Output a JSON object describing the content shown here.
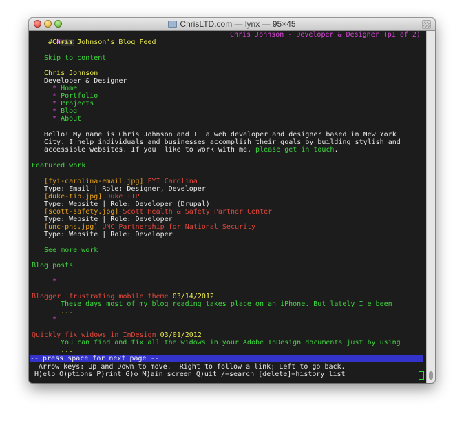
{
  "window": {
    "title": "ChrisLTD.com — lynx — 95×45"
  },
  "lynx": {
    "top_left_marker": "#",
    "back_link": "<<<",
    "page_heading": "#Chris Johnson's Blog Feed",
    "top_right_title": "Chris Johnson - Developer & Designer (p1 of 2)"
  },
  "page": {
    "skip": "Skip to content",
    "site_name": "Chris Johnson",
    "tagline": "Developer & Designer",
    "nav": [
      "Home",
      "Portfolio",
      "Projects",
      "Blog",
      "About"
    ],
    "bullet": "*",
    "intro": [
      "Hello! My name is Chris Johnson and I  a web developer and designer based in New York",
      "City. I help individuals and businesses accomplish their goals by building stylish and"
    ],
    "intro_line3_prefix": "accessible websites. If you  like to work with me, ",
    "intro_link": "please get in touch",
    "intro_line3_suffix": ".",
    "featured_heading": "Featured work",
    "featured": [
      {
        "img": "[fyi-carolina-email.jpg]",
        "title": "FYI Carolina",
        "meta": "Type: Email | Role: Designer, Developer"
      },
      {
        "img": "[duke-tip.jpg]",
        "title": "Duke TIP",
        "meta": "Type: Website | Role: Developer (Drupal)"
      },
      {
        "img": "[scott-safety.jpg]",
        "title": "Scott Health & Safety Partner Center",
        "meta": "Type: Website | Role: Developer"
      },
      {
        "img": "[unc-pns.jpg]",
        "title": "UNC Partnership for National Security",
        "meta": "Type: Website | Role: Developer"
      }
    ],
    "see_more": "See more work",
    "blog_heading": "Blog posts",
    "posts": [
      {
        "title": "Blogger  frustrating mobile theme",
        "date": "03/14/2012",
        "excerpt": "These days most of my blog reading takes place on an iPhone. But lately I e been",
        "more": "..."
      },
      {
        "title": "Quickly fix widows in InDesign",
        "date": "03/01/2012",
        "excerpt": "You can find and fix all the widows in your Adobe InDesign documents just by using",
        "more": "..."
      }
    ]
  },
  "status": {
    "prompt": "-- press space for next page --",
    "help1": "  Arrow keys: Up and Down to move.  Right to follow a link; Left to go back.",
    "help2": " H)elp O)ptions P)rint G)o M)ain screen Q)uit /=search [delete]=history list"
  },
  "colors": {
    "terminal_bg": "#1c1c1c",
    "link_green": "#3fd63f",
    "heading_yellow": "#e9e94a",
    "title_magenta": "#d746d7",
    "alt_text_orange": "#e6a11c",
    "status_blue": "#3333cc"
  }
}
